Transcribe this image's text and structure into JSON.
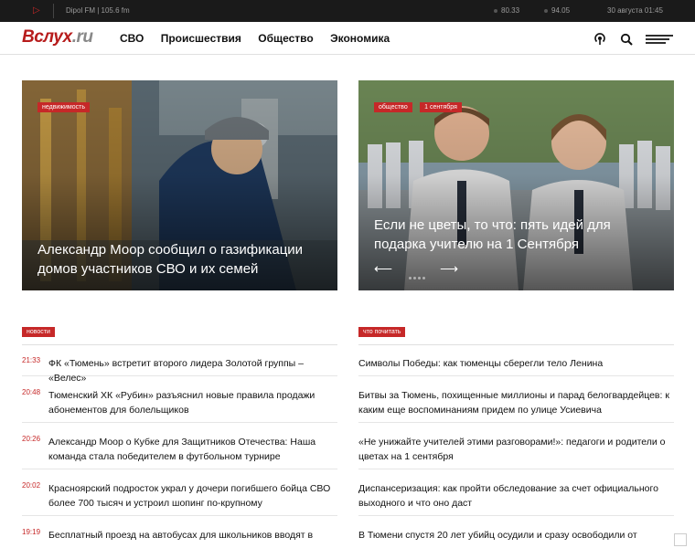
{
  "radio": {
    "station": "Dipol FM | 105.6 fm"
  },
  "rates": {
    "usd": "80.33",
    "eur": "94.05",
    "date": "30 августа 01:45"
  },
  "header": {
    "logo_main": "Вслух",
    "logo_ext": ".ru",
    "nav": [
      "СВО",
      "Происшествия",
      "Общество",
      "Экономика"
    ]
  },
  "hero_left": {
    "tags": [
      "недвижимость"
    ],
    "title": "Александр Моор сообщил о газификации домов участников СВО и их семей"
  },
  "hero_right": {
    "tags": [
      "общество",
      "1 сентября"
    ],
    "title": "Если не цветы, то что: пять идей для подарка учителю на 1 Сентября"
  },
  "news": {
    "label": "новости",
    "items": [
      {
        "time": "21:33",
        "text": "ФК «Тюмень» встретит второго лидера Золотой группы – «Велес»"
      },
      {
        "time": "20:48",
        "text": "Тюменский ХК «Рубин» разъяснил новые правила продажи абонементов для болельщиков"
      },
      {
        "time": "20:26",
        "text": "Александр Моор о Кубке для Защитников Отечества: Наша команда стала победителем в футбольном турнире"
      },
      {
        "time": "20:02",
        "text": "Красноярский подросток украл у дочери погибшего бойца СВО более 700 тысяч и устроил шопинг по-крупному"
      },
      {
        "time": "19:19",
        "text": "Бесплатный проезд на автобусах для школьников вводят в"
      }
    ]
  },
  "reads": {
    "label": "что почитать",
    "items": [
      {
        "text": "Символы Победы: как тюменцы сберегли тело Ленина"
      },
      {
        "text": "Битвы за Тюмень, похищенные миллионы и парад белогвардейцев: к каким еще воспоминаниям придем по улице Усиевича"
      },
      {
        "text": "«Не унижайте учителей этими разговорами!»: педагоги и родители о цветах на 1 сентября"
      },
      {
        "text": "Диспансеризация: как пройти обследование за счет официального выходного и что оно даст"
      },
      {
        "text": "В Тюмени спустя 20 лет убийц осудили и сразу освободили от"
      }
    ]
  }
}
